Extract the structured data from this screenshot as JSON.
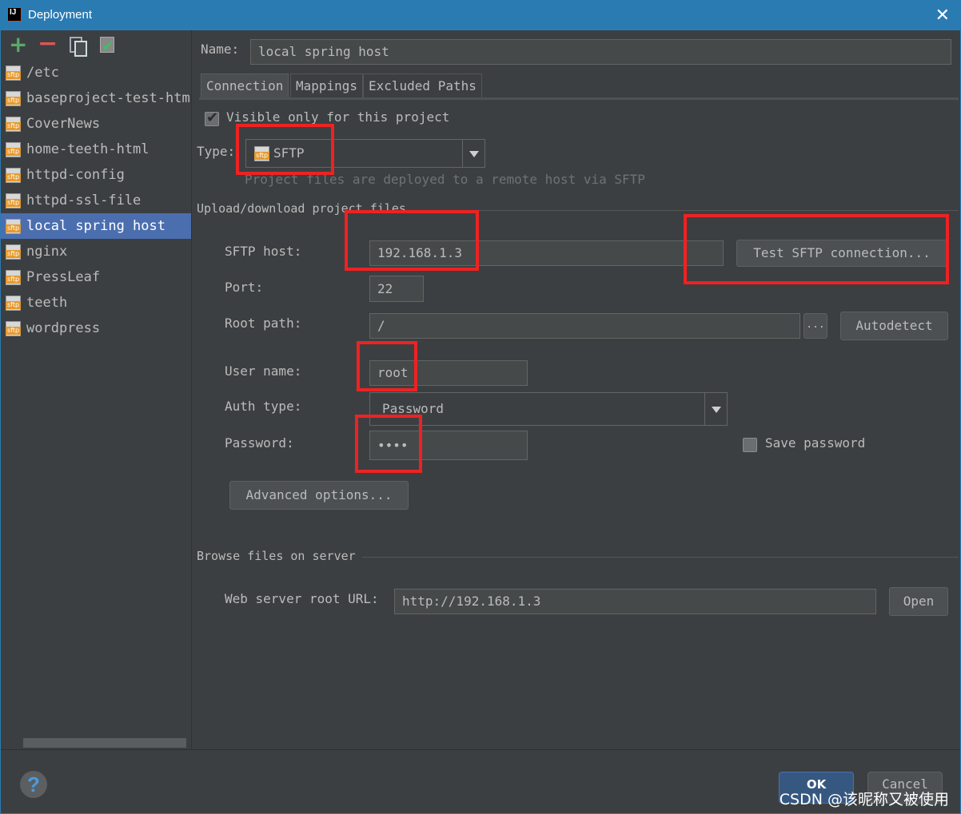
{
  "window": {
    "title": "Deployment"
  },
  "servers": [
    {
      "name": "/etc"
    },
    {
      "name": "baseproject-test-html"
    },
    {
      "name": "CoverNews"
    },
    {
      "name": "home-teeth-html"
    },
    {
      "name": "httpd-config"
    },
    {
      "name": "httpd-ssl-file"
    },
    {
      "name": "local spring host",
      "selected": true
    },
    {
      "name": "nginx"
    },
    {
      "name": "PressLeaf"
    },
    {
      "name": "teeth"
    },
    {
      "name": "wordpress"
    }
  ],
  "form": {
    "name_label": "Name:",
    "name_value": "local spring host",
    "tabs": [
      "Connection",
      "Mappings",
      "Excluded Paths"
    ],
    "active_tab": "Connection",
    "visible_only_label": "Visible only for this project",
    "visible_only_checked": true,
    "type_label": "Type:",
    "type_value": "SFTP",
    "type_hint": "Project files are deployed to a remote host via SFTP",
    "upload_section": "Upload/download project files",
    "sftp_host_label": "SFTP host:",
    "sftp_host_value": "192.168.1.3",
    "test_button": "Test SFTP connection...",
    "port_label": "Port:",
    "port_value": "22",
    "root_path_label": "Root path:",
    "root_path_value": "/",
    "browse_button": "...",
    "autodetect_button": "Autodetect",
    "user_name_label": "User name:",
    "user_name_value": "root",
    "auth_type_label": "Auth type:",
    "auth_type_value": "Password",
    "password_label": "Password:",
    "password_value": "••••",
    "save_password_label": "Save password",
    "save_password_checked": false,
    "advanced_button": "Advanced options...",
    "browse_section": "Browse files on server",
    "web_root_label": "Web server root URL:",
    "web_root_value": "http://192.168.1.3",
    "open_button": "Open"
  },
  "footer": {
    "help": "?",
    "ok": "OK",
    "cancel": "Cancel",
    "watermark": "CSDN @该昵称又被使用"
  },
  "colors": {
    "background": "#3c3f41",
    "selection": "#4b6eaf",
    "titlebar": "#2b7bb3",
    "highlight_box": "#ee2222"
  }
}
